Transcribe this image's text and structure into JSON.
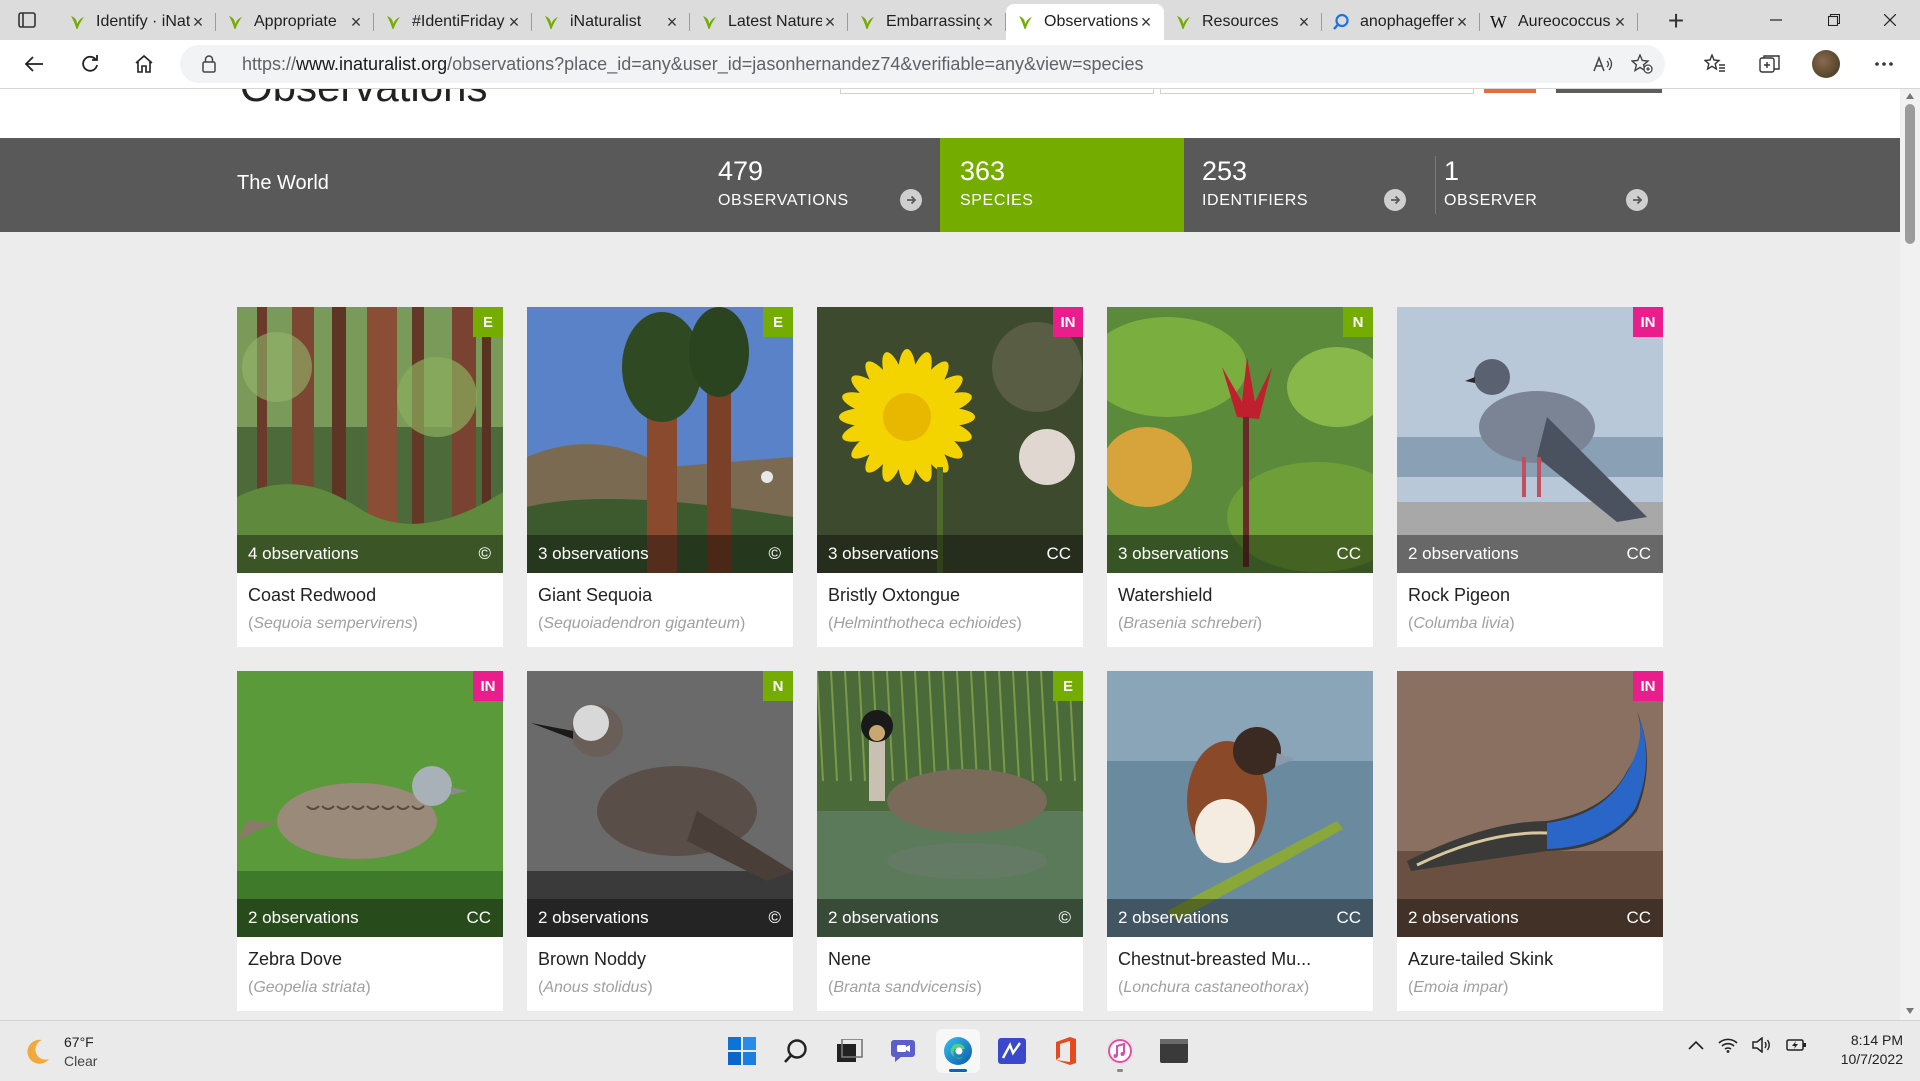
{
  "browser": {
    "tabs": [
      {
        "title": "Identify · iNaturalist",
        "favicon": "inaturalist-icon",
        "active": false
      },
      {
        "title": "Appropriate",
        "favicon": "inaturalist-icon",
        "active": false
      },
      {
        "title": "#IdentiFriday",
        "favicon": "inaturalist-icon",
        "active": false
      },
      {
        "title": "iNaturalist",
        "favicon": "inaturalist-icon",
        "active": false
      },
      {
        "title": "Latest Nature",
        "favicon": "inaturalist-icon",
        "active": false
      },
      {
        "title": "Embarrassing",
        "favicon": "inaturalist-icon",
        "active": false
      },
      {
        "title": "Observations",
        "favicon": "inaturalist-icon",
        "active": true
      },
      {
        "title": "Resources",
        "favicon": "inaturalist-icon",
        "active": false
      },
      {
        "title": "anophagefferens",
        "favicon": "search-icon",
        "active": false
      },
      {
        "title": "Aureococcus",
        "favicon": "wikipedia-icon",
        "active": false
      }
    ],
    "url_prefix": "https://",
    "url_host": "www.inaturalist.org",
    "url_path": "/observations?place_id=any&user_id=jasonhernandez74&verifiable=any&view=species"
  },
  "page": {
    "title": "Observations",
    "place": "The World",
    "stats": [
      {
        "count": "479",
        "label": "OBSERVATIONS",
        "active": false,
        "arrow": true
      },
      {
        "count": "363",
        "label": "SPECIES",
        "active": true,
        "arrow": false
      },
      {
        "count": "253",
        "label": "IDENTIFIERS",
        "active": false,
        "arrow": true
      },
      {
        "count": "1",
        "label": "OBSERVER",
        "active": false,
        "arrow": true
      }
    ]
  },
  "species": [
    {
      "common": "Coast Redwood",
      "scientific": "Sequoia sempervirens",
      "count": "4 observations",
      "license": "©",
      "badge": "E",
      "badge_color": "#74ac00",
      "scene": "redwood"
    },
    {
      "common": "Giant Sequoia",
      "scientific": "Sequoiadendron giganteum",
      "count": "3 observations",
      "license": "©",
      "badge": "E",
      "badge_color": "#74ac00",
      "scene": "sequoia"
    },
    {
      "common": "Bristly Oxtongue",
      "scientific": "Helminthotheca echioides",
      "count": "3 observations",
      "license": "CC",
      "badge": "IN",
      "badge_color": "#e91e8c",
      "scene": "flower"
    },
    {
      "common": "Watershield",
      "scientific": "Brasenia schreberi",
      "count": "3 observations",
      "license": "CC",
      "badge": "N",
      "badge_color": "#74ac00",
      "scene": "lily"
    },
    {
      "common": "Rock Pigeon",
      "scientific": "Columba livia",
      "count": "2 observations",
      "license": "CC",
      "badge": "IN",
      "badge_color": "#e91e8c",
      "scene": "pigeon"
    },
    {
      "common": "Zebra Dove",
      "scientific": "Geopelia striata",
      "count": "2 observations",
      "license": "CC",
      "badge": "IN",
      "badge_color": "#e91e8c",
      "scene": "dove"
    },
    {
      "common": "Brown Noddy",
      "scientific": "Anous stolidus",
      "count": "2 observations",
      "license": "©",
      "badge": "N",
      "badge_color": "#74ac00",
      "scene": "noddy"
    },
    {
      "common": "Nene",
      "scientific": "Branta sandvicensis",
      "count": "2 observations",
      "license": "©",
      "badge": "E",
      "badge_color": "#74ac00",
      "scene": "goose"
    },
    {
      "common": "Chestnut-breasted Mu...",
      "scientific": "Lonchura castaneothorax",
      "count": "2 observations",
      "license": "CC",
      "badge": "",
      "badge_color": "",
      "scene": "munia"
    },
    {
      "common": "Azure-tailed Skink",
      "scientific": "Emoia impar",
      "count": "2 observations",
      "license": "CC",
      "badge": "IN",
      "badge_color": "#e91e8c",
      "scene": "skink"
    }
  ],
  "taskbar": {
    "temperature": "67°F",
    "condition": "Clear",
    "time": "8:14 PM",
    "date": "10/7/2022"
  },
  "colors": {
    "inat_green": "#74ac00",
    "introduced_pink": "#e91e8c",
    "stats_bar": "#595959"
  }
}
